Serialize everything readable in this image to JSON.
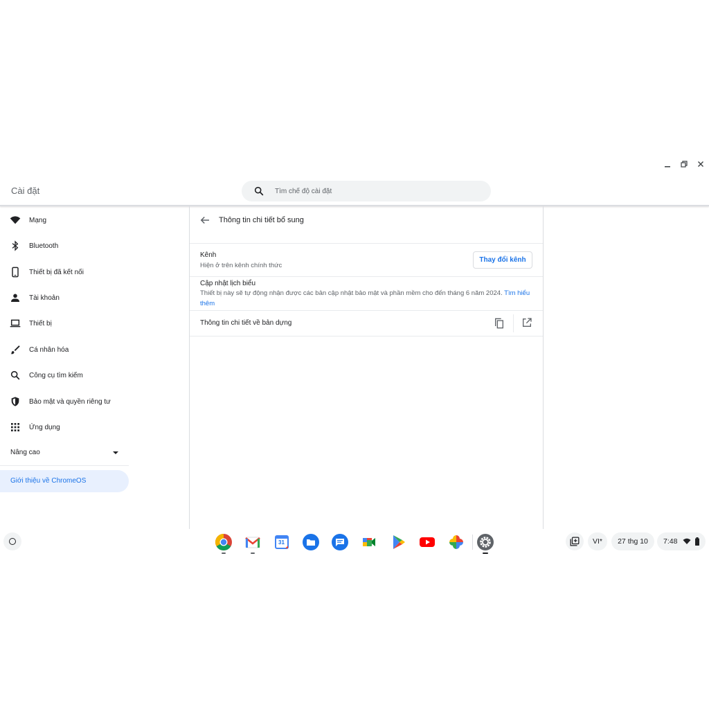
{
  "window": {
    "title": "Cài đặt",
    "minimize_label": "—",
    "close_label": "✕"
  },
  "search": {
    "placeholder": "Tìm chế độ cài đặt"
  },
  "sidebar": {
    "items": [
      {
        "label": "Mạng",
        "icon": "wifi-icon"
      },
      {
        "label": "Bluetooth",
        "icon": "bluetooth-icon"
      },
      {
        "label": "Thiết bị đã kết nối",
        "icon": "phone-icon"
      },
      {
        "label": "Tài khoản",
        "icon": "person-icon"
      },
      {
        "label": "Thiết bị",
        "icon": "laptop-icon"
      },
      {
        "label": "Cá nhân hóa",
        "icon": "brush-icon"
      },
      {
        "label": "Công cụ tìm kiếm",
        "icon": "search-icon"
      },
      {
        "label": "Bảo mật và quyền riêng tư",
        "icon": "shield-icon"
      },
      {
        "label": "Ứng dụng",
        "icon": "apps-grid-icon"
      }
    ],
    "advanced_label": "Nâng cao",
    "about_label": "Giới thiệu về ChromeOS"
  },
  "main": {
    "title": "Thông tin chi tiết bổ sung",
    "channel": {
      "title": "Kênh",
      "subtitle": "Hiện ở trên kênh chính thức",
      "button_label": "Thay đổi kênh"
    },
    "updates": {
      "title": "Cập nhật lịch biểu",
      "subtitle": "Thiết bị này sẽ tự động nhận được các bản cập nhật bảo mật và phần mềm cho đến tháng 6 năm 2024.",
      "link": "Tìm hiểu thêm"
    },
    "build": {
      "title": "Thông tin chi tiết về bản dựng"
    }
  },
  "shelf": {
    "apps": [
      "chrome-icon",
      "gmail-icon",
      "calendar-icon",
      "files-icon",
      "messages-icon",
      "meet-icon",
      "play-store-icon",
      "youtube-icon",
      "photos-icon",
      "settings-icon"
    ],
    "calendar_day": "31",
    "ime": "VI*",
    "date": "27 thg 10",
    "time": "7:48"
  },
  "colors": {
    "accent": "#1a73e8",
    "selected_bg": "#e8f0fe",
    "search_bg": "#f1f3f4"
  }
}
